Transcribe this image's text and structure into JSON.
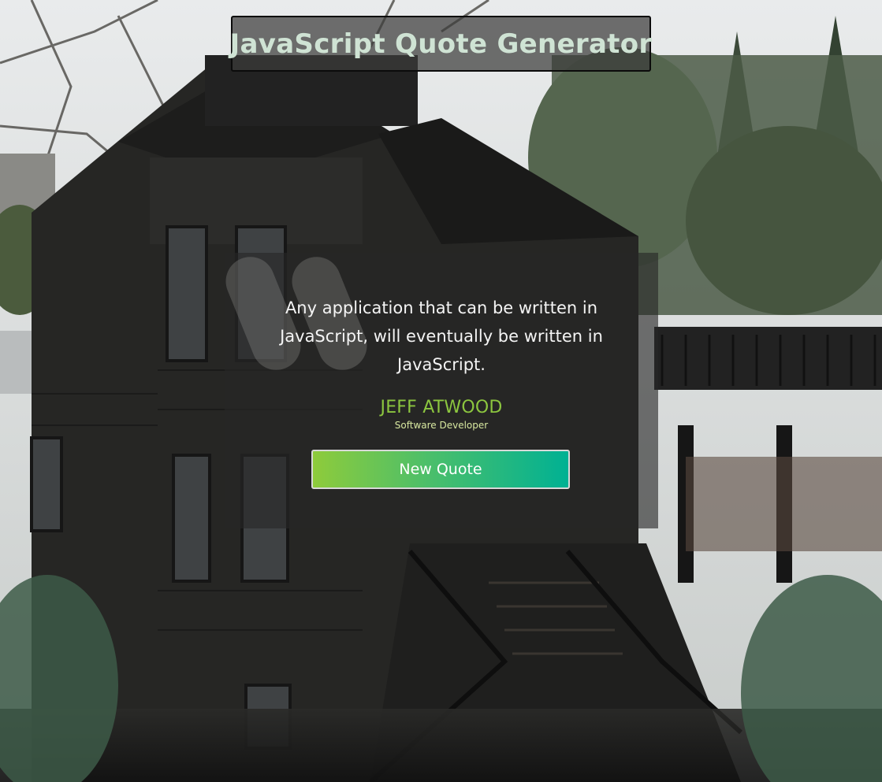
{
  "header": {
    "title": "JavaScript Quote Generator"
  },
  "quote": {
    "text": "Any application that can be written in JavaScript, will eventually be written in JavaScript.",
    "author": "JEFF ATWOOD",
    "role": "Software Developer"
  },
  "actions": {
    "new_quote_label": "New Quote"
  },
  "icons": {
    "quote_mark": "quote-mark-icon"
  },
  "colors": {
    "title_text": "#cfe3d4",
    "author_text": "#8cc63f",
    "button_gradient_start": "#8ecb3b",
    "button_gradient_end": "#00b193"
  }
}
